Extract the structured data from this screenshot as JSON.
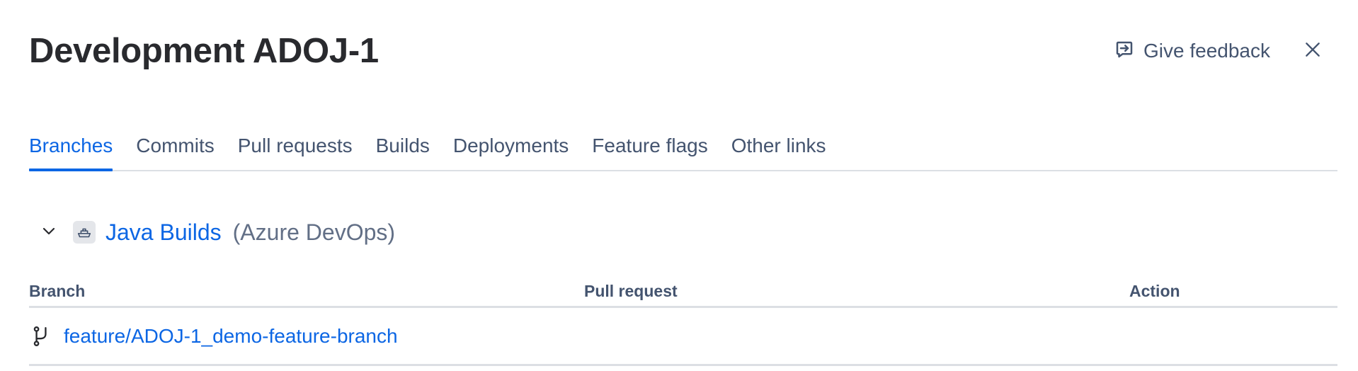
{
  "header": {
    "title": "Development ADOJ-1",
    "feedback_label": "Give feedback",
    "feedback_icon": "feedback-icon",
    "close_icon": "close-icon"
  },
  "tabs": [
    {
      "label": "Branches",
      "active": true
    },
    {
      "label": "Commits",
      "active": false
    },
    {
      "label": "Pull requests",
      "active": false
    },
    {
      "label": "Builds",
      "active": false
    },
    {
      "label": "Deployments",
      "active": false
    },
    {
      "label": "Feature flags",
      "active": false
    },
    {
      "label": "Other links",
      "active": false
    }
  ],
  "group": {
    "name": "Java Builds",
    "provider": "(Azure DevOps)",
    "expanded": true,
    "icon": "ship-icon"
  },
  "table": {
    "columns": [
      "Branch",
      "Pull request",
      "Action"
    ],
    "rows": [
      {
        "branch": "feature/ADOJ-1_demo-feature-branch",
        "pull_request": "",
        "action": ""
      }
    ]
  },
  "colors": {
    "accent": "#0c66e4",
    "text": "#292a2e",
    "subtle_text": "#44546f",
    "muted_text": "#626f86",
    "border": "#dcdfe4"
  }
}
